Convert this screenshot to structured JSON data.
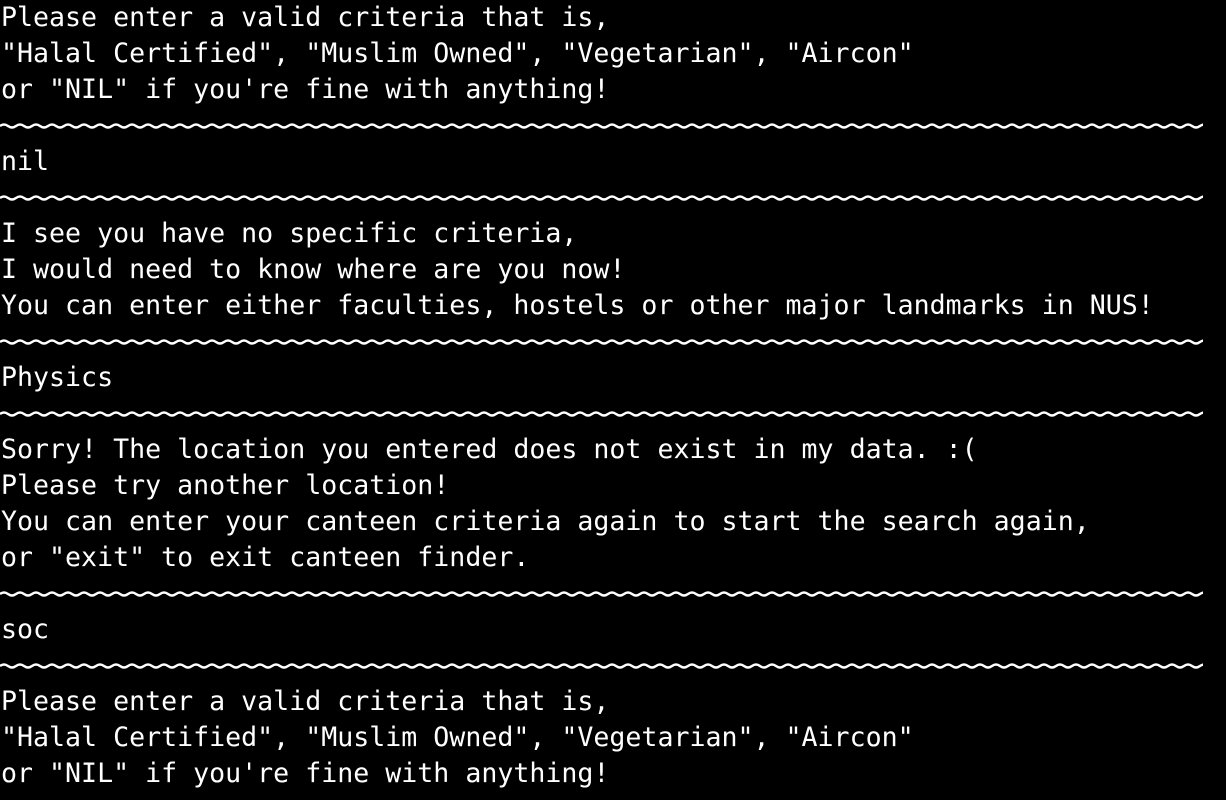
{
  "terminal": {
    "lines": [
      {
        "type": "text",
        "text": "Please enter a valid criteria that is,"
      },
      {
        "type": "text",
        "text": "\"Halal Certified\", \"Muslim Owned\", \"Vegetarian\", \"Aircon\""
      },
      {
        "type": "text",
        "text": "or \"NIL\" if you're fine with anything!"
      },
      {
        "type": "sep"
      },
      {
        "type": "text",
        "text": "nil"
      },
      {
        "type": "sep"
      },
      {
        "type": "text",
        "text": "I see you have no specific criteria,"
      },
      {
        "type": "text",
        "text": "I would need to know where are you now!"
      },
      {
        "type": "text",
        "text": "You can enter either faculties, hostels or other major landmarks in NUS!"
      },
      {
        "type": "sep"
      },
      {
        "type": "text",
        "text": "Physics"
      },
      {
        "type": "sep"
      },
      {
        "type": "text",
        "text": "Sorry! The location you entered does not exist in my data. :("
      },
      {
        "type": "text",
        "text": "Please try another location!"
      },
      {
        "type": "text",
        "text": "You can enter your canteen criteria again to start the search again,"
      },
      {
        "type": "text",
        "text": "or \"exit\" to exit canteen finder."
      },
      {
        "type": "sep"
      },
      {
        "type": "text",
        "text": "soc"
      },
      {
        "type": "sep"
      },
      {
        "type": "text",
        "text": "Please enter a valid criteria that is,"
      },
      {
        "type": "text",
        "text": "\"Halal Certified\", \"Muslim Owned\", \"Vegetarian\", \"Aircon\""
      },
      {
        "type": "text",
        "text": "or \"NIL\" if you're fine with anything!"
      }
    ]
  },
  "colors": {
    "background": "#000000",
    "foreground": "#ffffff"
  }
}
